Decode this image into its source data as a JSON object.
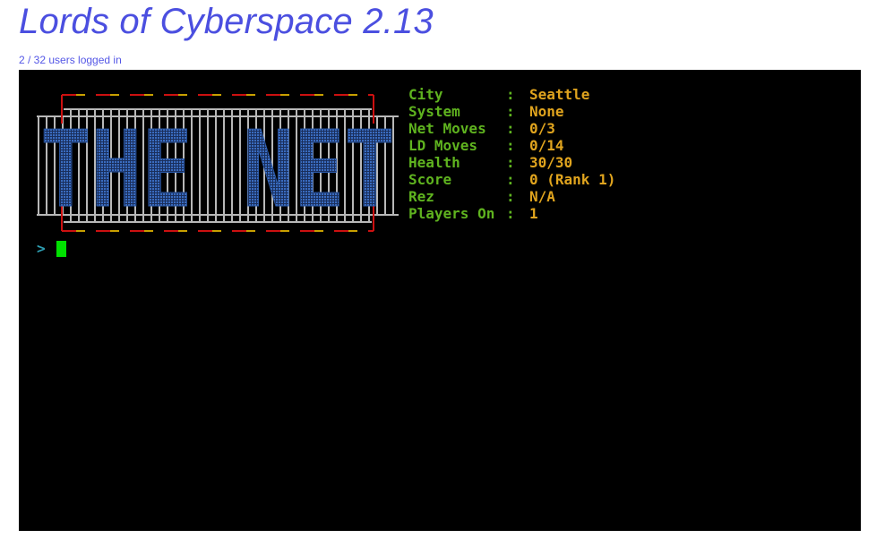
{
  "page": {
    "title": "Lords of Cyberspace 2.13",
    "users_logged_in": "2 / 32 users logged in"
  },
  "logo": {
    "text": "THE NET"
  },
  "stats": [
    {
      "label": "City",
      "value": "Seattle"
    },
    {
      "label": "System",
      "value": "None"
    },
    {
      "label": "Net Moves",
      "value": "0/3"
    },
    {
      "label": "LD Moves",
      "value": "0/14"
    },
    {
      "label": "Health",
      "value": "30/30"
    },
    {
      "label": "Score",
      "value": "0 (Rank 1)"
    },
    {
      "label": "Rez",
      "value": "N/A"
    },
    {
      "label": "Players On",
      "value": "1"
    }
  ],
  "prompt": {
    "glyph": ">"
  },
  "colors": {
    "title": "#4b4fe0",
    "stat_label": "#5fb31f",
    "stat_value": "#e0a41e",
    "prompt": "#2e9fb3",
    "cursor": "#00e000",
    "logo_text": "#2c5aa8",
    "logo_border_red": "#cc1010",
    "logo_border_yellow": "#c8a000",
    "logo_grid": "#b8b8b8"
  }
}
